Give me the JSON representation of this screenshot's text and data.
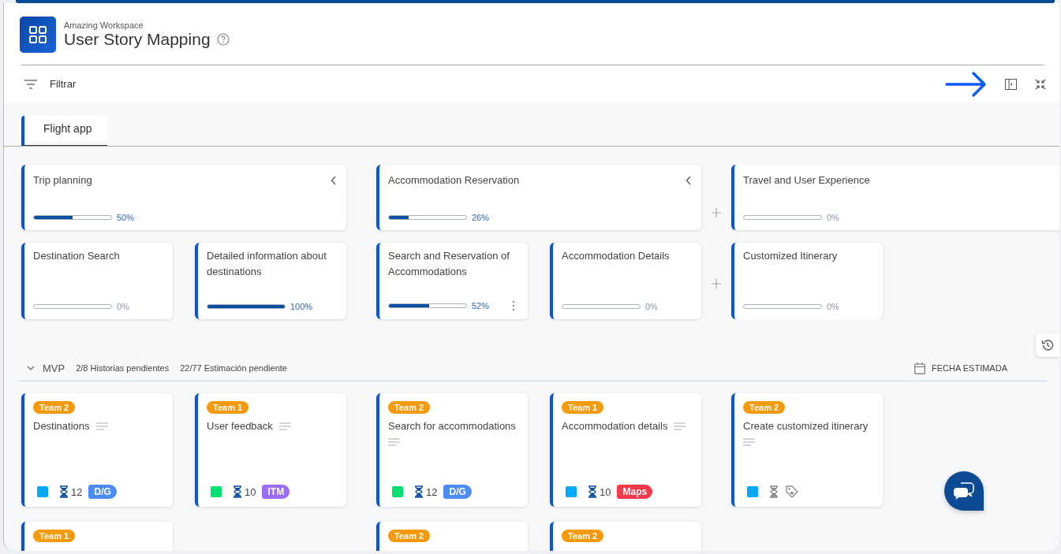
{
  "header": {
    "workspace": "Amazing Workspace",
    "title": "User Story Mapping"
  },
  "toolbar": {
    "filter_label": "Filtrar"
  },
  "tabs": [
    {
      "label": "Flight app",
      "selected": true
    }
  ],
  "groups": [
    {
      "kind": "group",
      "epic": {
        "title": "Trip planning",
        "level": 0.5,
        "percent": "50%"
      },
      "features": [
        {
          "title": "Destination Search",
          "level": 0,
          "percent": "0%",
          "show_menu": false
        },
        {
          "title": "Detailed information about destinations",
          "level": 1,
          "percent": "100%",
          "show_menu": false
        }
      ]
    },
    {
      "kind": "group",
      "epic": {
        "title": "Accommodation Reservation",
        "level": 0.26,
        "percent": "26%"
      },
      "features": [
        {
          "title": "Search and Reservation of Accommodations",
          "level": 0.52,
          "percent": "52%",
          "show_menu": true
        },
        {
          "title": "Accommodation Details",
          "level": 0,
          "percent": "0%",
          "show_menu": false
        }
      ]
    },
    {
      "kind": "add_column"
    },
    {
      "kind": "group",
      "epic": {
        "title": "Travel and User Experience",
        "level": 0,
        "percent": "0%"
      },
      "features": [
        {
          "title": "Customized Itinerary",
          "level": 0,
          "percent": "0%",
          "show_menu": false
        }
      ]
    }
  ],
  "release": {
    "expanded": true,
    "name": "MVP",
    "stories_pending": "2/8 Historias pendientes",
    "estimate_pending": "22/77 Estimación pendiente",
    "date_label": "FECHA ESTIMADA"
  },
  "story_rows": [
    {
      "cards": [
        {
          "kind": "story",
          "team": "Team 2",
          "title": "Destinations",
          "color": "#00a8ff",
          "estimate": "12",
          "tag": {
            "label": "D/G",
            "color": "#4b8df8"
          }
        },
        {
          "kind": "story",
          "team": "Team 1",
          "title": "User feedback",
          "color": "#00e070",
          "estimate": "10",
          "tag": {
            "label": "ITM",
            "color": "#9b6cf6"
          }
        },
        {
          "kind": "story",
          "team": "Team 2",
          "title": "Search for accommodations",
          "color": "#00e070",
          "estimate": "12",
          "tag": {
            "label": "D/G",
            "color": "#4b8df8"
          }
        },
        {
          "kind": "story",
          "team": "Team 1",
          "title": "Accommodation details",
          "color": "#00a8ff",
          "estimate": "10",
          "tag": {
            "label": "Maps",
            "color": "#f5394a"
          }
        },
        {
          "kind": "story",
          "team": "Team 2",
          "title": "Create customized itinerary",
          "color": "#00a8ff"
        }
      ]
    },
    {
      "cards": [
        {
          "kind": "story",
          "team": "Team 1"
        },
        {
          "kind": "empty"
        },
        {
          "kind": "story",
          "team": "Team 2"
        },
        {
          "kind": "story",
          "team": "Team 2"
        }
      ]
    }
  ]
}
